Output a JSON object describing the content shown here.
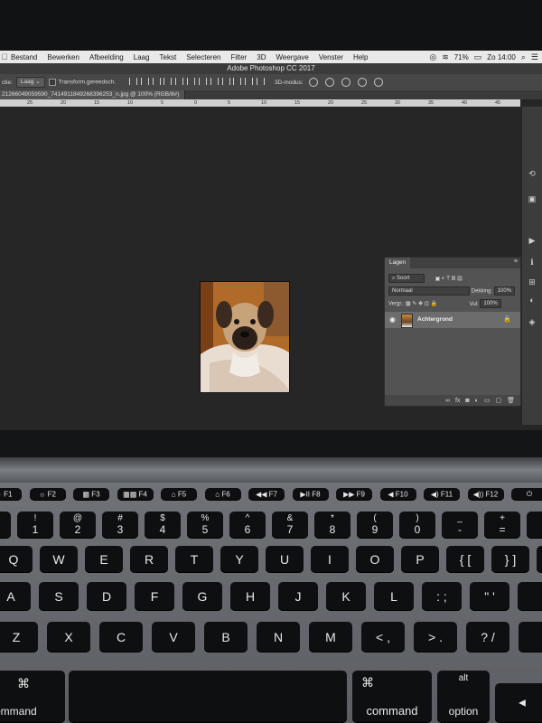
{
  "menubar": {
    "apple": "",
    "items": [
      "Bestand",
      "Bewerken",
      "Afbeelding",
      "Laag",
      "Tekst",
      "Selecteren",
      "Filter",
      "3D",
      "Weergave",
      "Venster",
      "Help"
    ],
    "battery": "71%",
    "clock": "Zo 14:00"
  },
  "titlebar": {
    "title": "Adobe Photoshop CC 2017"
  },
  "options": {
    "select_label": "ctie:",
    "select_value": "Laag",
    "transform_label": "Transform.gereedsch.",
    "mode_3d": "3D-modus:"
  },
  "document": {
    "tab": "21266049059590_7414911849268396253_n.jpg @ 100% (RGB/8#)",
    "ruler_ticks": [
      "25",
      "20",
      "15",
      "10",
      "5",
      "0",
      "5",
      "10",
      "15",
      "20",
      "25",
      "30",
      "35",
      "40",
      "45"
    ]
  },
  "layers_panel": {
    "tab": "Lagen",
    "filter": "Soort",
    "blend": "Normaal",
    "opacity_label": "Dekking:",
    "opacity_value": "100%",
    "lock_label": "Vergr.:",
    "fill_label": "Vul:",
    "fill_value": "100%",
    "layer_name": "Achtergrond"
  },
  "keyboard": {
    "fn_row": [
      {
        "top": "☼",
        "bot": "F1"
      },
      {
        "top": "☼",
        "bot": "F2"
      },
      {
        "top": "▦",
        "bot": "F3"
      },
      {
        "top": "▦▦",
        "bot": "F4"
      },
      {
        "top": "⌂",
        "bot": "F5"
      },
      {
        "top": "⌂",
        "bot": "F6"
      },
      {
        "top": "◀◀",
        "bot": "F7"
      },
      {
        "top": "▶II",
        "bot": "F8"
      },
      {
        "top": "▶▶",
        "bot": "F9"
      },
      {
        "top": "◀",
        "bot": "F10"
      },
      {
        "top": "◀)",
        "bot": "F11"
      },
      {
        "top": "◀))",
        "bot": "F12"
      },
      {
        "top": "⏻",
        "bot": ""
      }
    ],
    "number_row": [
      {
        "top": "~",
        "bot": "`"
      },
      {
        "top": "!",
        "bot": "1"
      },
      {
        "top": "@",
        "bot": "2"
      },
      {
        "top": "#",
        "bot": "3"
      },
      {
        "top": "$",
        "bot": "4"
      },
      {
        "top": "%",
        "bot": "5"
      },
      {
        "top": "^",
        "bot": "6"
      },
      {
        "top": "&",
        "bot": "7"
      },
      {
        "top": "*",
        "bot": "8"
      },
      {
        "top": "(",
        "bot": "9"
      },
      {
        "top": ")",
        "bot": "0"
      },
      {
        "top": "_",
        "bot": "-"
      },
      {
        "top": "+",
        "bot": "="
      },
      {
        "top": "",
        "bot": ""
      }
    ],
    "qwerty_row": [
      "Q",
      "W",
      "E",
      "R",
      "T",
      "Y",
      "U",
      "I",
      "O",
      "P",
      "{ [",
      "} ]",
      "|"
    ],
    "home_row": [
      "A",
      "S",
      "D",
      "F",
      "G",
      "H",
      "J",
      "K",
      "L",
      ": ;",
      "\" '",
      ""
    ],
    "bottom_letter_row": [
      "Z",
      "X",
      "C",
      "V",
      "B",
      "N",
      "M",
      "< ,",
      "> .",
      "? /",
      ""
    ],
    "modifiers": {
      "command_left": "command",
      "command_left_symbol": "⌘",
      "command_right": "command",
      "command_right_symbol": "⌘",
      "option_right": "option",
      "option_right_symbol": "alt"
    }
  }
}
